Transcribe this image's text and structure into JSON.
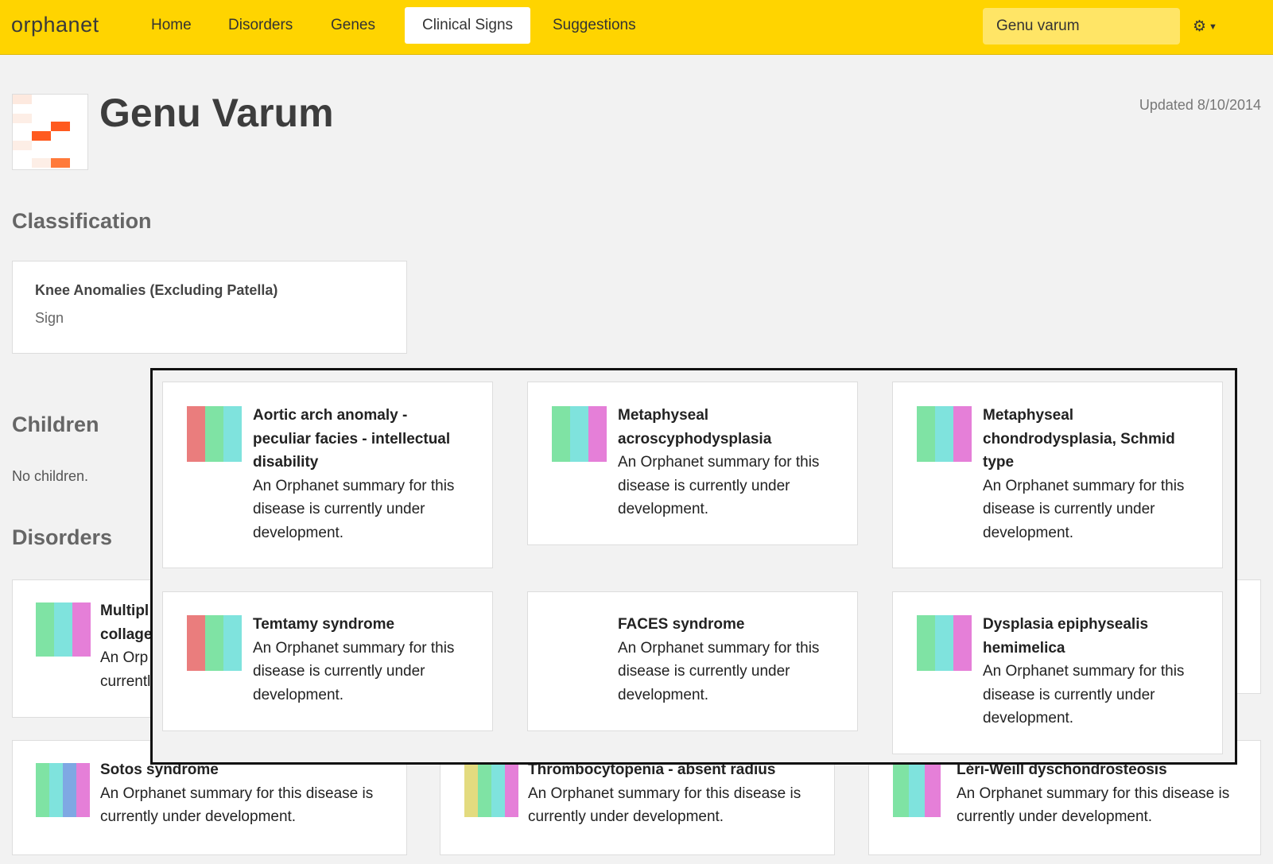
{
  "nav": {
    "logo": "orphanet",
    "items": [
      {
        "label": "Home",
        "active": false
      },
      {
        "label": "Disorders",
        "active": false
      },
      {
        "label": "Genes",
        "active": false
      },
      {
        "label": "Clinical Signs",
        "active": true
      },
      {
        "label": "Suggestions",
        "active": false
      }
    ],
    "search_value": "Genu varum",
    "settings_icon": "gear-icon",
    "brand_color": "#ffd400"
  },
  "header": {
    "title": "Genu Varum",
    "updated": "Updated 8/10/2014"
  },
  "classification": {
    "heading": "Classification",
    "name": "Knee Anomalies (Excluding Patella)",
    "type": "Sign"
  },
  "children": {
    "heading": "Children",
    "empty_text": "No children."
  },
  "disorders": {
    "heading": "Disorders",
    "partial_card": {
      "title_1": "Multipl",
      "title_2": "collage",
      "line_1": "An Orp",
      "line_2": "currentl"
    },
    "bottom_cards": [
      {
        "title": "Sotos syndrome",
        "summary_1": "An Orphanet summary for this disease is",
        "summary_2": "currently under development."
      },
      {
        "title": "Thrombocytopenia - absent radius",
        "summary_1": "An Orphanet summary for this disease is",
        "summary_2": "currently under development."
      },
      {
        "title": "Léri-Weill dyschondrosteosis",
        "summary_1": "An Orphanet summary for this disease is",
        "summary_2": "currently under development."
      }
    ]
  },
  "popup_cards": [
    {
      "title": [
        "Aortic arch anomaly -",
        "peculiar facies - intellectual",
        "disability"
      ],
      "summary": [
        "An Orphanet summary for this",
        "disease is currently under",
        "development."
      ]
    },
    {
      "title": [
        "Metaphyseal",
        "acroscyphodysplasia"
      ],
      "summary": [
        "An Orphanet summary for this",
        "disease is currently under",
        "development."
      ]
    },
    {
      "title": [
        "Metaphyseal",
        "chondrodysplasia, Schmid",
        "type"
      ],
      "summary": [
        "An Orphanet summary for this",
        "disease is currently under",
        "development."
      ]
    },
    {
      "title": [
        "Temtamy syndrome"
      ],
      "summary": [
        "An Orphanet summary for this",
        "disease is currently under",
        "development."
      ]
    },
    {
      "title": [
        "FACES syndrome"
      ],
      "summary": [
        "An Orphanet summary for this",
        "disease is currently under",
        "development."
      ]
    },
    {
      "title": [
        "Dysplasia epiphysealis",
        "hemimelica"
      ],
      "summary": [
        "An Orphanet summary for this",
        "disease is currently under",
        "development."
      ]
    }
  ],
  "colors": {
    "red": "#ea7d7d",
    "green": "#7fe3a4",
    "teal": "#7fe3dd",
    "pink": "#e57fd8",
    "blue": "#7fa8e3",
    "yellow": "#e3db7f"
  }
}
